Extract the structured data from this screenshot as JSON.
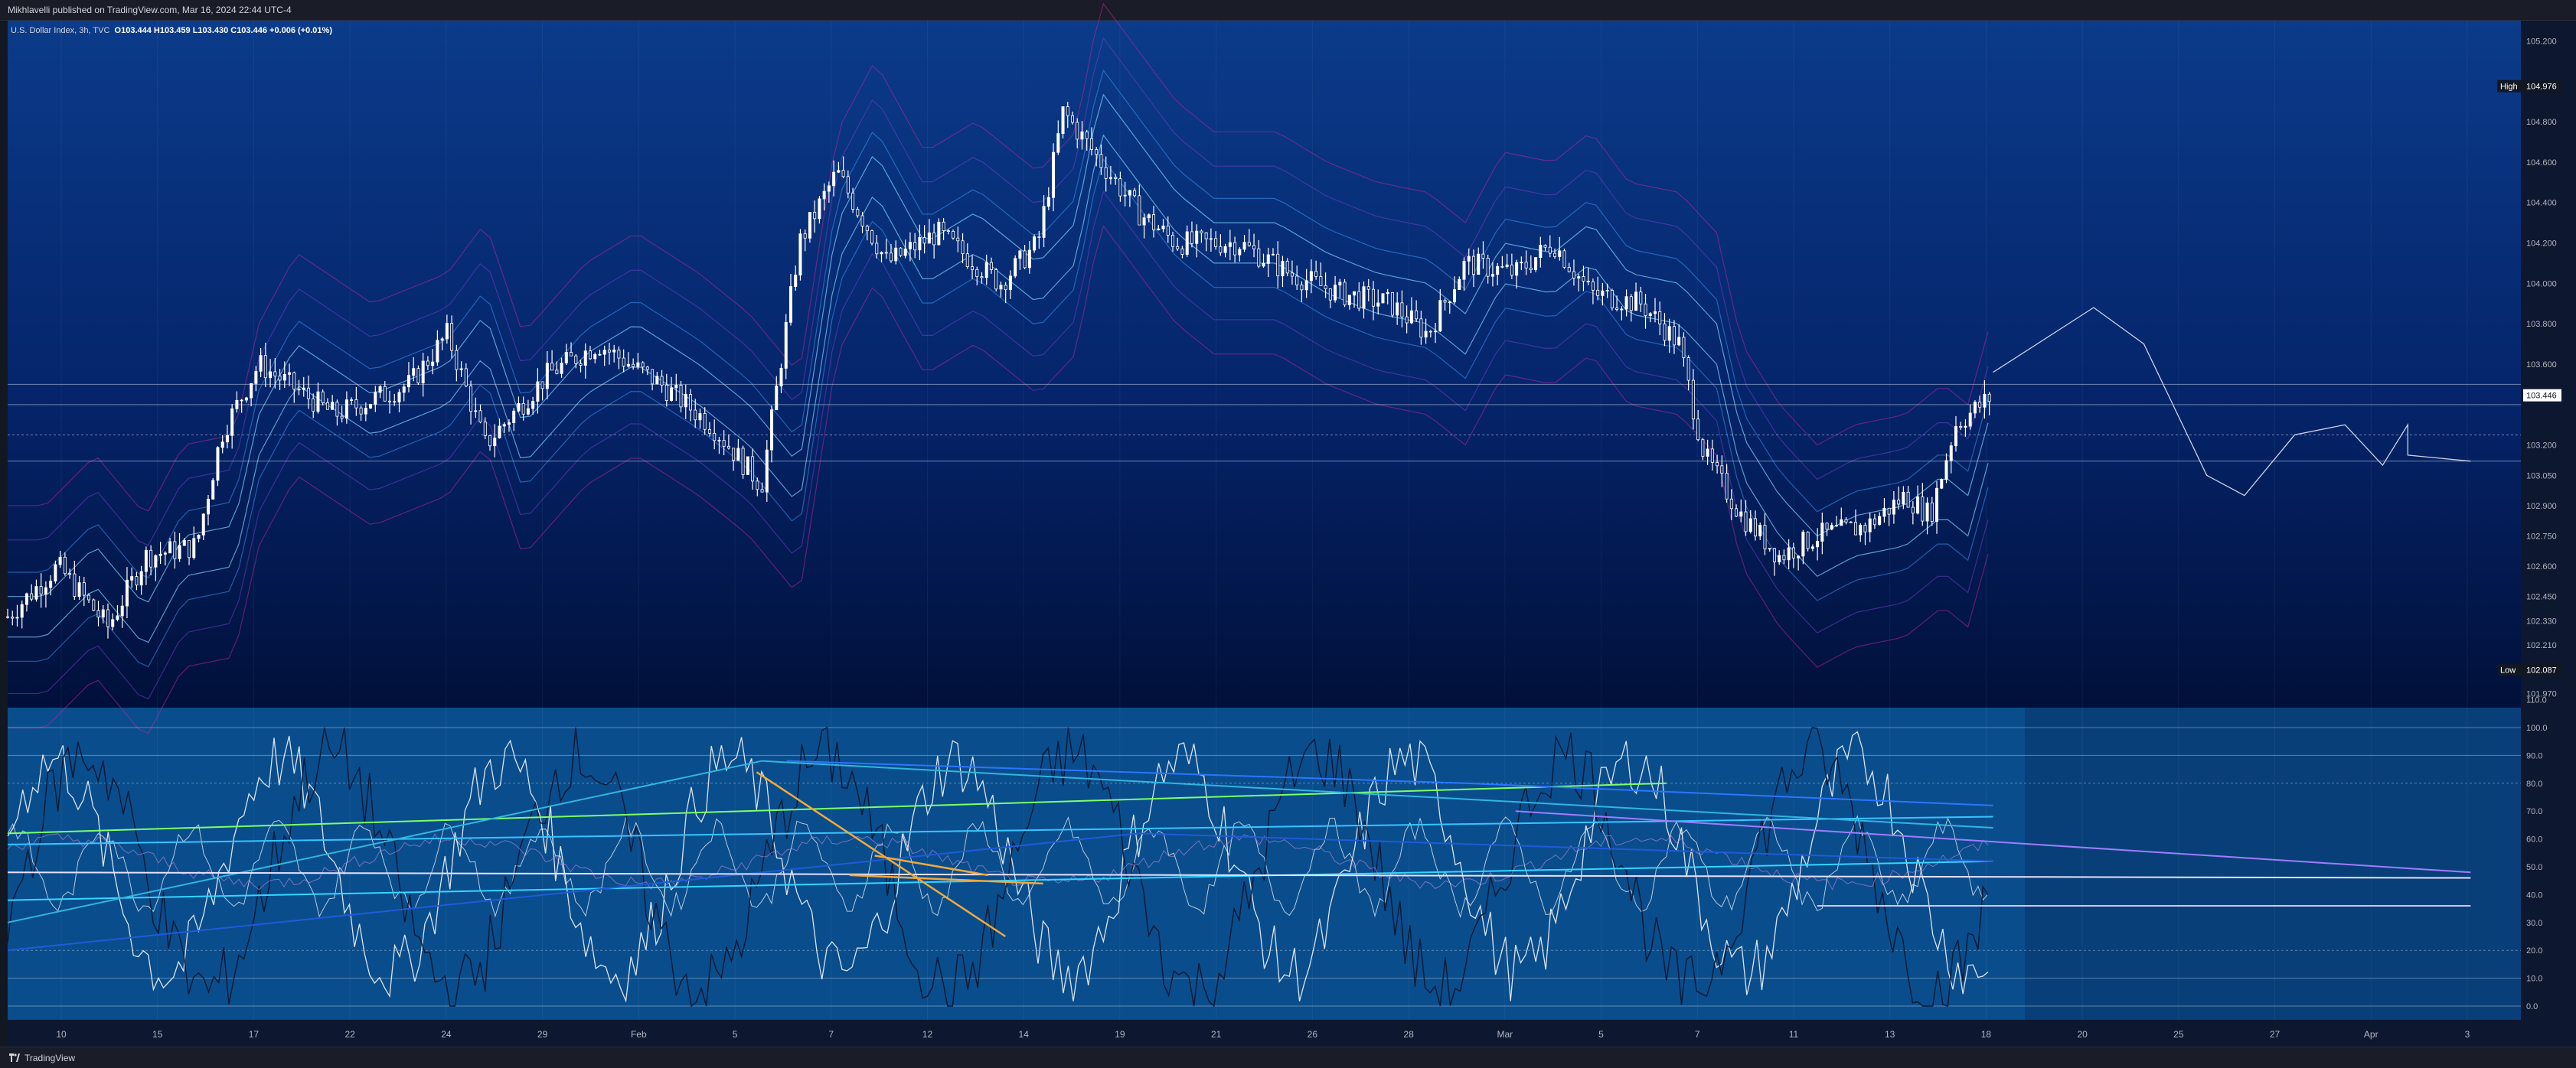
{
  "header": {
    "published": "Mikhlavelli published on TradingView.com, Mar 16, 2024 22:44 UTC-4"
  },
  "legend": {
    "symbol": "U.S. Dollar Index, 3h, TVC",
    "o": "O103.444",
    "h": "H103.459",
    "l": "L103.430",
    "c": "C103.446",
    "chg": "+0.006 (+0.01%)"
  },
  "footer": {
    "brand": "TradingView"
  },
  "colors": {
    "background_top": "#0b3b8a",
    "background_bottom": "#01103a",
    "candles": "#ffffff",
    "osc_panel": "#0a4d8c"
  },
  "chart_data": [
    {
      "type": "candlestick",
      "panel": "price",
      "ylim": [
        101.9,
        105.3
      ],
      "y_ticks": [
        "105.200",
        "104.976",
        "104.800",
        "104.600",
        "104.400",
        "104.200",
        "104.000",
        "103.800",
        "103.600",
        "103.446",
        "103.200",
        "103.050",
        "102.900",
        "102.750",
        "102.600",
        "102.450",
        "102.330",
        "102.210",
        "102.087",
        "101.970"
      ],
      "high_label": "High",
      "high_value": "104.976",
      "low_label": "Low",
      "low_value": "102.087",
      "last_value": "103.446",
      "x_ticks": [
        "10",
        "15",
        "17",
        "22",
        "24",
        "29",
        "Feb",
        "5",
        "7",
        "12",
        "14",
        "19",
        "21",
        "26",
        "28",
        "Mar",
        "5",
        "7",
        "11",
        "13",
        "18",
        "20",
        "25",
        "27",
        "Apr",
        "3"
      ],
      "path_points": [
        [
          0,
          102.35
        ],
        [
          0.02,
          102.6
        ],
        [
          0.04,
          102.3
        ],
        [
          0.055,
          102.65
        ],
        [
          0.075,
          102.7
        ],
        [
          0.085,
          103.25
        ],
        [
          0.1,
          103.6
        ],
        [
          0.13,
          103.35
        ],
        [
          0.16,
          103.5
        ],
        [
          0.175,
          103.75
        ],
        [
          0.19,
          103.2
        ],
        [
          0.215,
          103.55
        ],
        [
          0.235,
          103.7
        ],
        [
          0.26,
          103.5
        ],
        [
          0.28,
          103.3
        ],
        [
          0.3,
          103.0
        ],
        [
          0.315,
          104.2
        ],
        [
          0.33,
          104.55
        ],
        [
          0.35,
          104.1
        ],
        [
          0.37,
          104.25
        ],
        [
          0.395,
          104.0
        ],
        [
          0.41,
          104.2
        ],
        [
          0.42,
          104.85
        ],
        [
          0.435,
          104.6
        ],
        [
          0.45,
          104.35
        ],
        [
          0.465,
          104.2
        ],
        [
          0.49,
          104.2
        ],
        [
          0.51,
          104.05
        ],
        [
          0.53,
          103.95
        ],
        [
          0.55,
          103.9
        ],
        [
          0.565,
          103.75
        ],
        [
          0.58,
          104.1
        ],
        [
          0.6,
          104.05
        ],
        [
          0.615,
          104.2
        ],
        [
          0.63,
          103.95
        ],
        [
          0.65,
          103.9
        ],
        [
          0.665,
          103.7
        ],
        [
          0.675,
          103.15
        ],
        [
          0.69,
          102.85
        ],
        [
          0.705,
          102.65
        ],
        [
          0.72,
          102.75
        ],
        [
          0.74,
          102.8
        ],
        [
          0.755,
          102.95
        ],
        [
          0.765,
          102.85
        ],
        [
          0.775,
          103.3
        ],
        [
          0.79,
          103.446
        ]
      ],
      "projection_points": [
        [
          0.79,
          103.56
        ],
        [
          0.83,
          103.88
        ],
        [
          0.85,
          103.7
        ],
        [
          0.875,
          103.05
        ],
        [
          0.89,
          102.95
        ],
        [
          0.91,
          103.25
        ],
        [
          0.93,
          103.3
        ],
        [
          0.945,
          103.1
        ],
        [
          0.955,
          103.3
        ],
        [
          0.955,
          103.15
        ],
        [
          0.98,
          103.12
        ]
      ],
      "horizontal_levels": [
        103.5,
        103.4,
        103.25,
        103.12
      ]
    },
    {
      "type": "line",
      "panel": "oscillator",
      "ylim": [
        0,
        110
      ],
      "y_ticks": [
        "110.0",
        "100.0",
        "90.0",
        "80.0",
        "70.0",
        "60.0",
        "50.0",
        "40.0",
        "30.0",
        "20.0",
        "10.0",
        "0.0"
      ],
      "levels": [
        100,
        90,
        80,
        20,
        10,
        0
      ]
    }
  ]
}
